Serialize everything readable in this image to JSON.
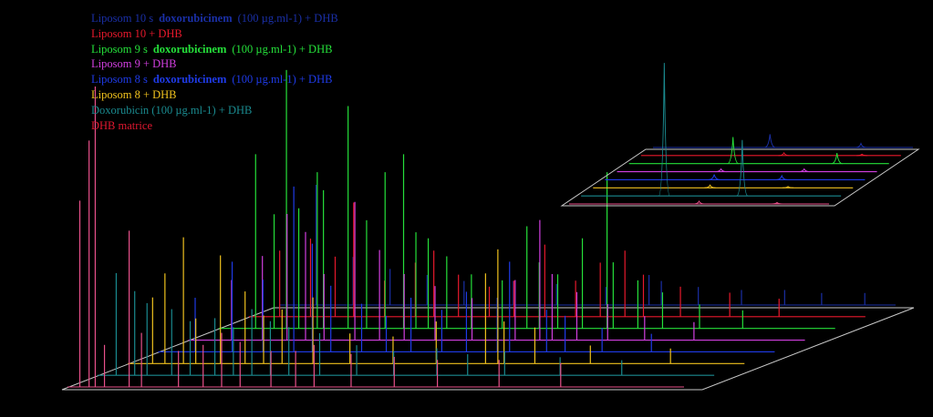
{
  "chart_data": {
    "type": "line",
    "view": "3D stacked (waterfall) mass spectra",
    "axes": "no axis labels or ticks printed",
    "background": "#000000",
    "legend": {
      "placement": "top-left",
      "entries": [
        {
          "prefix": "Liposom 10 s",
          "bold": "doxorubicinem",
          "suffix": "(100 µg.ml-1) + DHB",
          "color": "#1a2fa6"
        },
        {
          "prefix": "Liposom 10 + DHB",
          "bold": "",
          "suffix": "",
          "color": "#e8192c"
        },
        {
          "prefix": "Liposom 9 s",
          "bold": "doxorubicinem",
          "suffix": "(100 µg.ml-1) + DHB",
          "color": "#25e03a"
        },
        {
          "prefix": "Liposom 9 + DHB",
          "bold": "",
          "suffix": "",
          "color": "#d23fe0"
        },
        {
          "prefix": "Liposom 8 s",
          "bold": "doxorubicinem",
          "suffix": "(100 µg.ml-1) + DHB",
          "color": "#1f3be8"
        },
        {
          "prefix": "Liposom 8 + DHB",
          "bold": "",
          "suffix": "",
          "color": "#f0c21e"
        },
        {
          "prefix": "Doxorubicin (100 µg.ml-1) + DHB",
          "bold": "",
          "suffix": "",
          "color": "#1a8a8f"
        },
        {
          "prefix": "DHB matrice",
          "bold": "",
          "suffix": "",
          "color": "#e01830"
        }
      ]
    },
    "main_panel": {
      "x_range": [
        0,
        100
      ],
      "y_range": [
        0,
        100
      ],
      "series": [
        {
          "name": "DHB matrice",
          "color": "#e8508a",
          "peaks": [
            [
              2,
              62
            ],
            [
              3.5,
              82
            ],
            [
              4.5,
              100
            ],
            [
              6,
              14
            ],
            [
              10,
              52
            ],
            [
              12,
              18
            ],
            [
              18,
              12
            ],
            [
              22,
              14
            ],
            [
              25,
              18
            ],
            [
              28,
              15
            ],
            [
              33,
              12
            ],
            [
              37,
              12
            ],
            [
              40,
              14
            ],
            [
              46,
              11
            ],
            [
              53,
              10
            ],
            [
              60,
              9
            ],
            [
              70,
              9
            ],
            [
              80,
              8
            ]
          ]
        },
        {
          "name": "Doxorubicin (100 µg.ml-1) + DHB",
          "color": "#1a8a8f",
          "peaks": [
            [
              3,
              34
            ],
            [
              6,
              28
            ],
            [
              8,
              24
            ],
            [
              12,
              22
            ],
            [
              15,
              18
            ],
            [
              19,
              19
            ],
            [
              22,
              16
            ],
            [
              25,
              22
            ],
            [
              28,
              18
            ],
            [
              31,
              16
            ],
            [
              36,
              14
            ],
            [
              42,
              10
            ],
            [
              48,
              8
            ],
            [
              55,
              9
            ],
            [
              60,
              7
            ],
            [
              66,
              8
            ],
            [
              75,
              6
            ],
            [
              85,
              5
            ]
          ]
        },
        {
          "name": "Liposom 8 + DHB",
          "color": "#f0c21e",
          "peaks": [
            [
              4,
              22
            ],
            [
              6,
              30
            ],
            [
              9,
              42
            ],
            [
              11,
              15
            ],
            [
              15,
              36
            ],
            [
              19,
              24
            ],
            [
              22,
              16
            ],
            [
              25,
              18
            ],
            [
              30,
              22
            ],
            [
              36,
              10
            ],
            [
              43,
              9
            ],
            [
              50,
              14
            ],
            [
              58,
              30
            ],
            [
              60,
              38
            ],
            [
              61,
              14
            ],
            [
              66,
              12
            ],
            [
              75,
              6
            ],
            [
              88,
              5
            ]
          ]
        },
        {
          "name": "Liposom 8 s doxorubicinem (100 µg.ml-1) + DHB",
          "color": "#1f3be8",
          "peaks": [
            [
              6,
              18
            ],
            [
              12,
              30
            ],
            [
              17,
              24
            ],
            [
              22,
              55
            ],
            [
              25,
              36
            ],
            [
              28,
              22
            ],
            [
              33,
              16
            ],
            [
              37,
              12
            ],
            [
              41,
              18
            ],
            [
              46,
              14
            ],
            [
              50,
              20
            ],
            [
              55,
              18
            ],
            [
              57,
              30
            ],
            [
              63,
              14
            ],
            [
              66,
              12
            ],
            [
              72,
              8
            ],
            [
              80,
              6
            ]
          ]
        },
        {
          "name": "Liposom 9 + DHB",
          "color": "#d23fe0",
          "peaks": [
            [
              7,
              20
            ],
            [
              12,
              28
            ],
            [
              16,
              42
            ],
            [
              19,
              36
            ],
            [
              22,
              22
            ],
            [
              27,
              46
            ],
            [
              31,
              30
            ],
            [
              35,
              22
            ],
            [
              40,
              18
            ],
            [
              46,
              14
            ],
            [
              53,
              20
            ],
            [
              57,
              40
            ],
            [
              59,
              22
            ],
            [
              63,
              16
            ],
            [
              68,
              12
            ],
            [
              74,
              8
            ],
            [
              82,
              6
            ]
          ]
        },
        {
          "name": "Liposom 9 s doxorubicinem (100 µg.ml-1) + DHB",
          "color": "#25e03a",
          "peaks": [
            [
              6,
              58
            ],
            [
              9,
              38
            ],
            [
              11,
              86
            ],
            [
              13,
              40
            ],
            [
              16,
              52
            ],
            [
              17,
              46
            ],
            [
              21,
              74
            ],
            [
              24,
              36
            ],
            [
              27,
              52
            ],
            [
              30,
              58
            ],
            [
              32,
              32
            ],
            [
              34,
              30
            ],
            [
              37,
              24
            ],
            [
              41,
              18
            ],
            [
              46,
              16
            ],
            [
              50,
              34
            ],
            [
              52,
              22
            ],
            [
              55,
              18
            ],
            [
              59,
              30
            ],
            [
              63,
              52
            ],
            [
              64,
              22
            ],
            [
              68,
              16
            ],
            [
              72,
              12
            ],
            [
              78,
              8
            ],
            [
              85,
              6
            ]
          ]
        },
        {
          "name": "Liposom 10 + DHB",
          "color": "#e8192c",
          "peaks": [
            [
              5,
              22
            ],
            [
              10,
              26
            ],
            [
              14,
              20
            ],
            [
              17,
              38
            ],
            [
              22,
              12
            ],
            [
              27,
              18
            ],
            [
              30,
              22
            ],
            [
              34,
              14
            ],
            [
              39,
              10
            ],
            [
              43,
              12
            ],
            [
              48,
              24
            ],
            [
              53,
              12
            ],
            [
              57,
              18
            ],
            [
              61,
              22
            ],
            [
              64,
              14
            ],
            [
              70,
              10
            ],
            [
              78,
              8
            ],
            [
              86,
              6
            ]
          ]
        },
        {
          "name": "Liposom 10 s doxorubicinem (100 µg.ml-1) + DHB",
          "color": "#1a2fa6",
          "peaks": [
            [
              6,
              40
            ],
            [
              12,
              16
            ],
            [
              18,
              12
            ],
            [
              24,
              10
            ],
            [
              30,
              8
            ],
            [
              38,
              8
            ],
            [
              45,
              7
            ],
            [
              53,
              6
            ],
            [
              60,
              10
            ],
            [
              62,
              8
            ],
            [
              68,
              6
            ],
            [
              75,
              5
            ],
            [
              82,
              5
            ],
            [
              88,
              4
            ],
            [
              95,
              4
            ]
          ]
        }
      ]
    },
    "inset_panel": {
      "x_range": [
        0,
        100
      ],
      "y_range": [
        0,
        100
      ],
      "series": [
        {
          "name": "DHB matrice",
          "color": "#e8508a",
          "peaks": [
            [
              50,
              2
            ],
            [
              80,
              1
            ]
          ]
        },
        {
          "name": "Doxorubicin (100 µg.ml-1) + DHB",
          "color": "#1a8a8f",
          "peaks": [
            [
              32,
              100
            ],
            [
              62,
              42
            ]
          ]
        },
        {
          "name": "Liposom 8 + DHB",
          "color": "#f0c21e",
          "peaks": [
            [
              45,
              2
            ],
            [
              75,
              1
            ]
          ]
        },
        {
          "name": "Liposom 8 s doxorubicinem (100 µg.ml-1) + DHB",
          "color": "#1f3be8",
          "peaks": [
            [
              42,
              4
            ],
            [
              68,
              3
            ]
          ]
        },
        {
          "name": "Liposom 9 + DHB",
          "color": "#d23fe0",
          "peaks": [
            [
              40,
              2
            ],
            [
              72,
              2
            ]
          ]
        },
        {
          "name": "Liposom 9 s doxorubicinem (100 µg.ml-1) + DHB",
          "color": "#25e03a",
          "peaks": [
            [
              40,
              20
            ],
            [
              80,
              8
            ]
          ]
        },
        {
          "name": "Liposom 10 + DHB",
          "color": "#e8192c",
          "peaks": [
            [
              55,
              2
            ],
            [
              85,
              1
            ]
          ]
        },
        {
          "name": "Liposom 10 s doxorubicinem (100 µg.ml-1) + DHB",
          "color": "#1a2fa6",
          "peaks": [
            [
              45,
              10
            ],
            [
              80,
              3
            ]
          ]
        }
      ]
    }
  }
}
